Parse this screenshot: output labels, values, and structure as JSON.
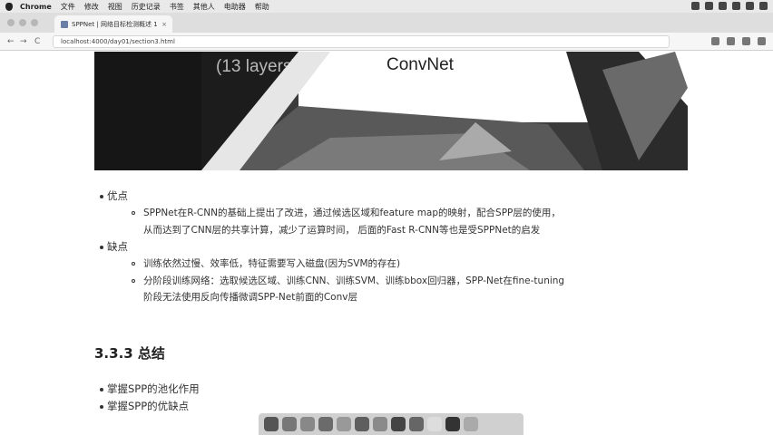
{
  "menubar": {
    "items": [
      "Chrome",
      "文件",
      "修改",
      "视图",
      "历史记录",
      "书签",
      "其他人",
      "电助器",
      "帮助"
    ]
  },
  "tab": {
    "title": "SPPNet | 网络目标检测概述 1",
    "close": "×"
  },
  "address": {
    "url": "localhost:4000/day01/section3.html",
    "back": "←",
    "forward": "→",
    "reload": "C"
  },
  "hero": {
    "left_text": "(13 layers)",
    "right_text": "ConvNet"
  },
  "content": {
    "pros_title": "优点",
    "pros_items": [
      "SPPNet在R-CNN的基础上提出了改进，通过候选区域和feature map的映射，配合SPP层的使用，",
      "从而达到了CNN层的共享计算，减少了运算时间， 后面的Fast R-CNN等也是受SPPNet的启发"
    ],
    "cons_title": "缺点",
    "cons_items": [
      "训练依然过慢、效率低，特征需要写入磁盘(因为SVM的存在)",
      "分阶段训练网络：选取候选区域、训练CNN、训练SVM、训练bbox回归器，SPP-Net在fine-tuning",
      "阶段无法使用反向传播微调SPP-Net前面的Conv层"
    ],
    "section_heading": "3.3.3 总结",
    "summary_items": [
      "掌握SPP的池化作用",
      "掌握SPP的优缺点"
    ]
  },
  "colors": {
    "menubar": "#e9e9e9",
    "tabbar": "#dedede",
    "hero_bg": "#161616",
    "accent_line": "#6f8fc2"
  }
}
